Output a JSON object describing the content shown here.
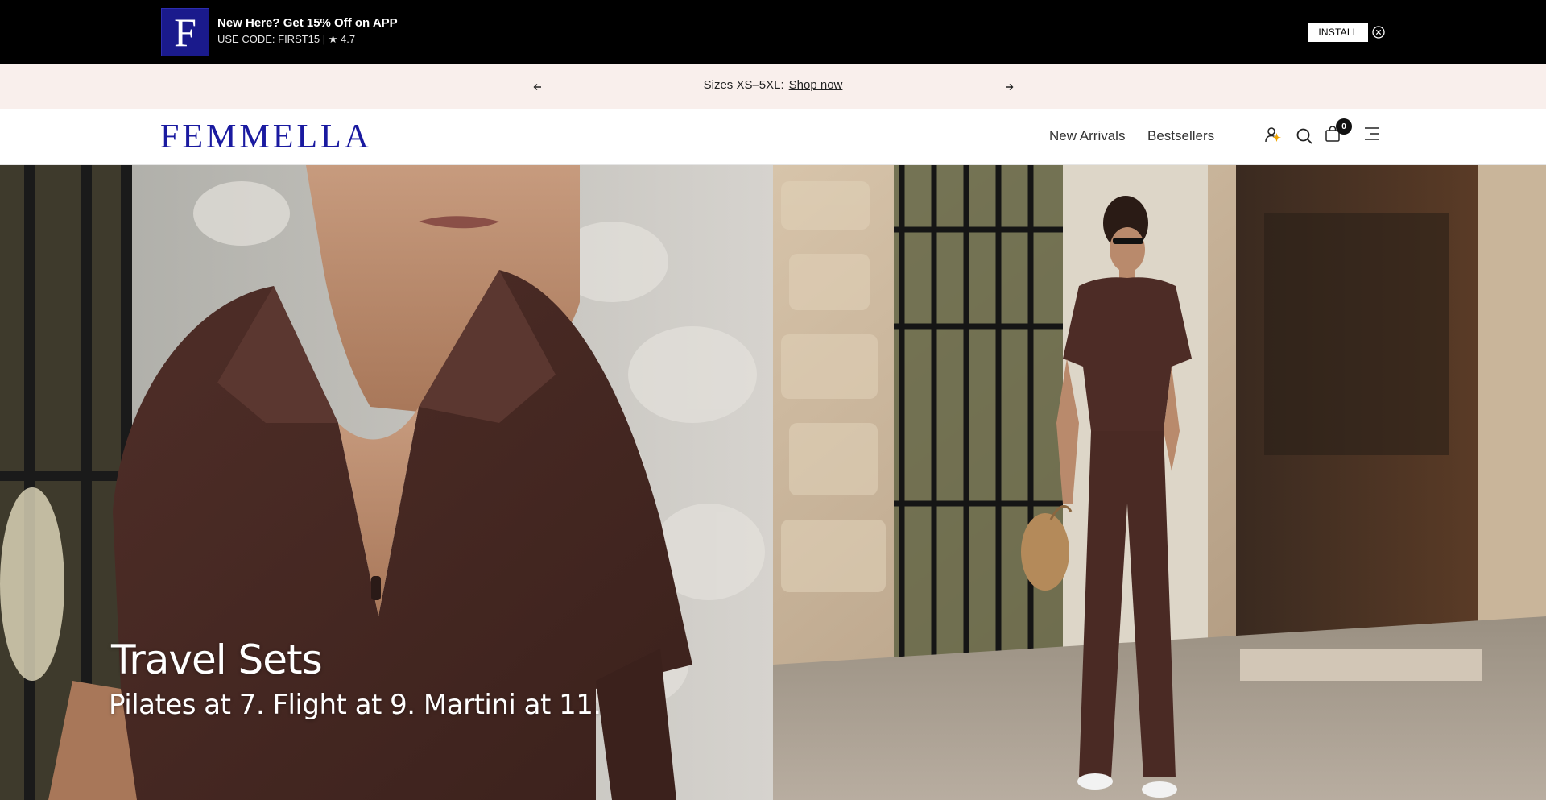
{
  "promo": {
    "logo_letter": "F",
    "title": "New Here? Get 15% Off on APP",
    "subtitle": "USE CODE: FIRST15 | ★ 4.7",
    "install_label": "INSTALL",
    "close_icon": "close-circle-icon"
  },
  "announcement": {
    "text": "Sizes XS–5XL:",
    "link": "Shop now",
    "prev_icon": "arrow-left-icon",
    "next_icon": "arrow-right-icon"
  },
  "header": {
    "brand": "FEMMELLA",
    "nav": [
      {
        "label": "New Arrivals"
      },
      {
        "label": "Bestsellers"
      }
    ],
    "icons": [
      "user-sparkle-icon",
      "search-icon",
      "shopping-bag-icon",
      "menu-icon"
    ],
    "cart_count": "0"
  },
  "hero": {
    "title": "Travel Sets",
    "subtitle": "Pilates at 7. Flight at 9. Martini at 11."
  },
  "colors": {
    "brand_blue": "#1a1aa0",
    "promo_bg": "#000000",
    "announce_bg": "#f9efec",
    "garment_brown": "#4a2a24"
  }
}
